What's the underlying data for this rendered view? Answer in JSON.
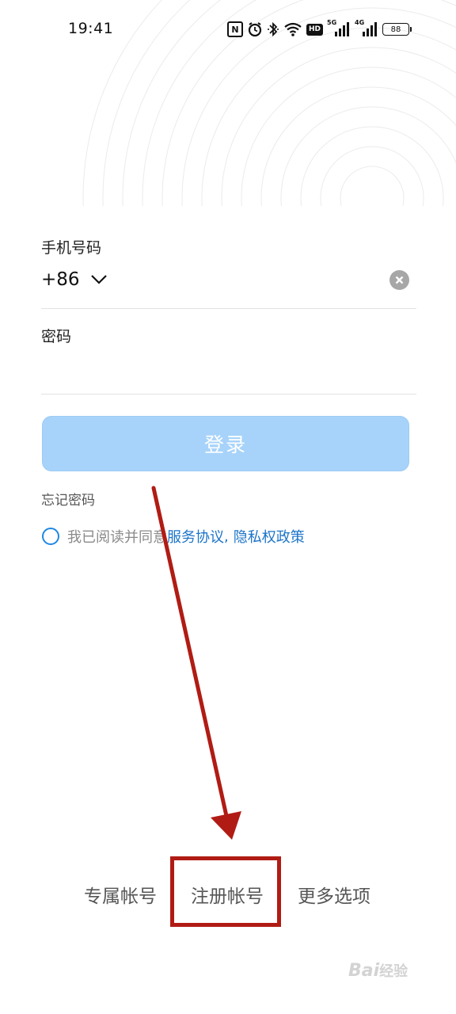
{
  "status_bar": {
    "time": "19:41",
    "nfc_label": "N",
    "hd_label": "HD",
    "net1_label": "5G",
    "net2_label": "4G",
    "battery": "88"
  },
  "form": {
    "phone_label": "手机号码",
    "country_code": "+86",
    "password_label": "密码",
    "password_value": ""
  },
  "login_button": "登录",
  "forgot_password": "忘记密码",
  "agreement": {
    "prefix": "我已阅读并同意",
    "service": "服务协议",
    "separator": ",",
    "privacy": "隐私权政策"
  },
  "bottom_options": {
    "exclusive": "专属帐号",
    "register": "注册帐号",
    "more": "更多选项"
  },
  "watermark": {
    "brand": "Bai",
    "suffix": "经验"
  },
  "colors": {
    "accent": "#1e88e5",
    "button": "#a7d3fa",
    "annotation": "#b01c14"
  }
}
